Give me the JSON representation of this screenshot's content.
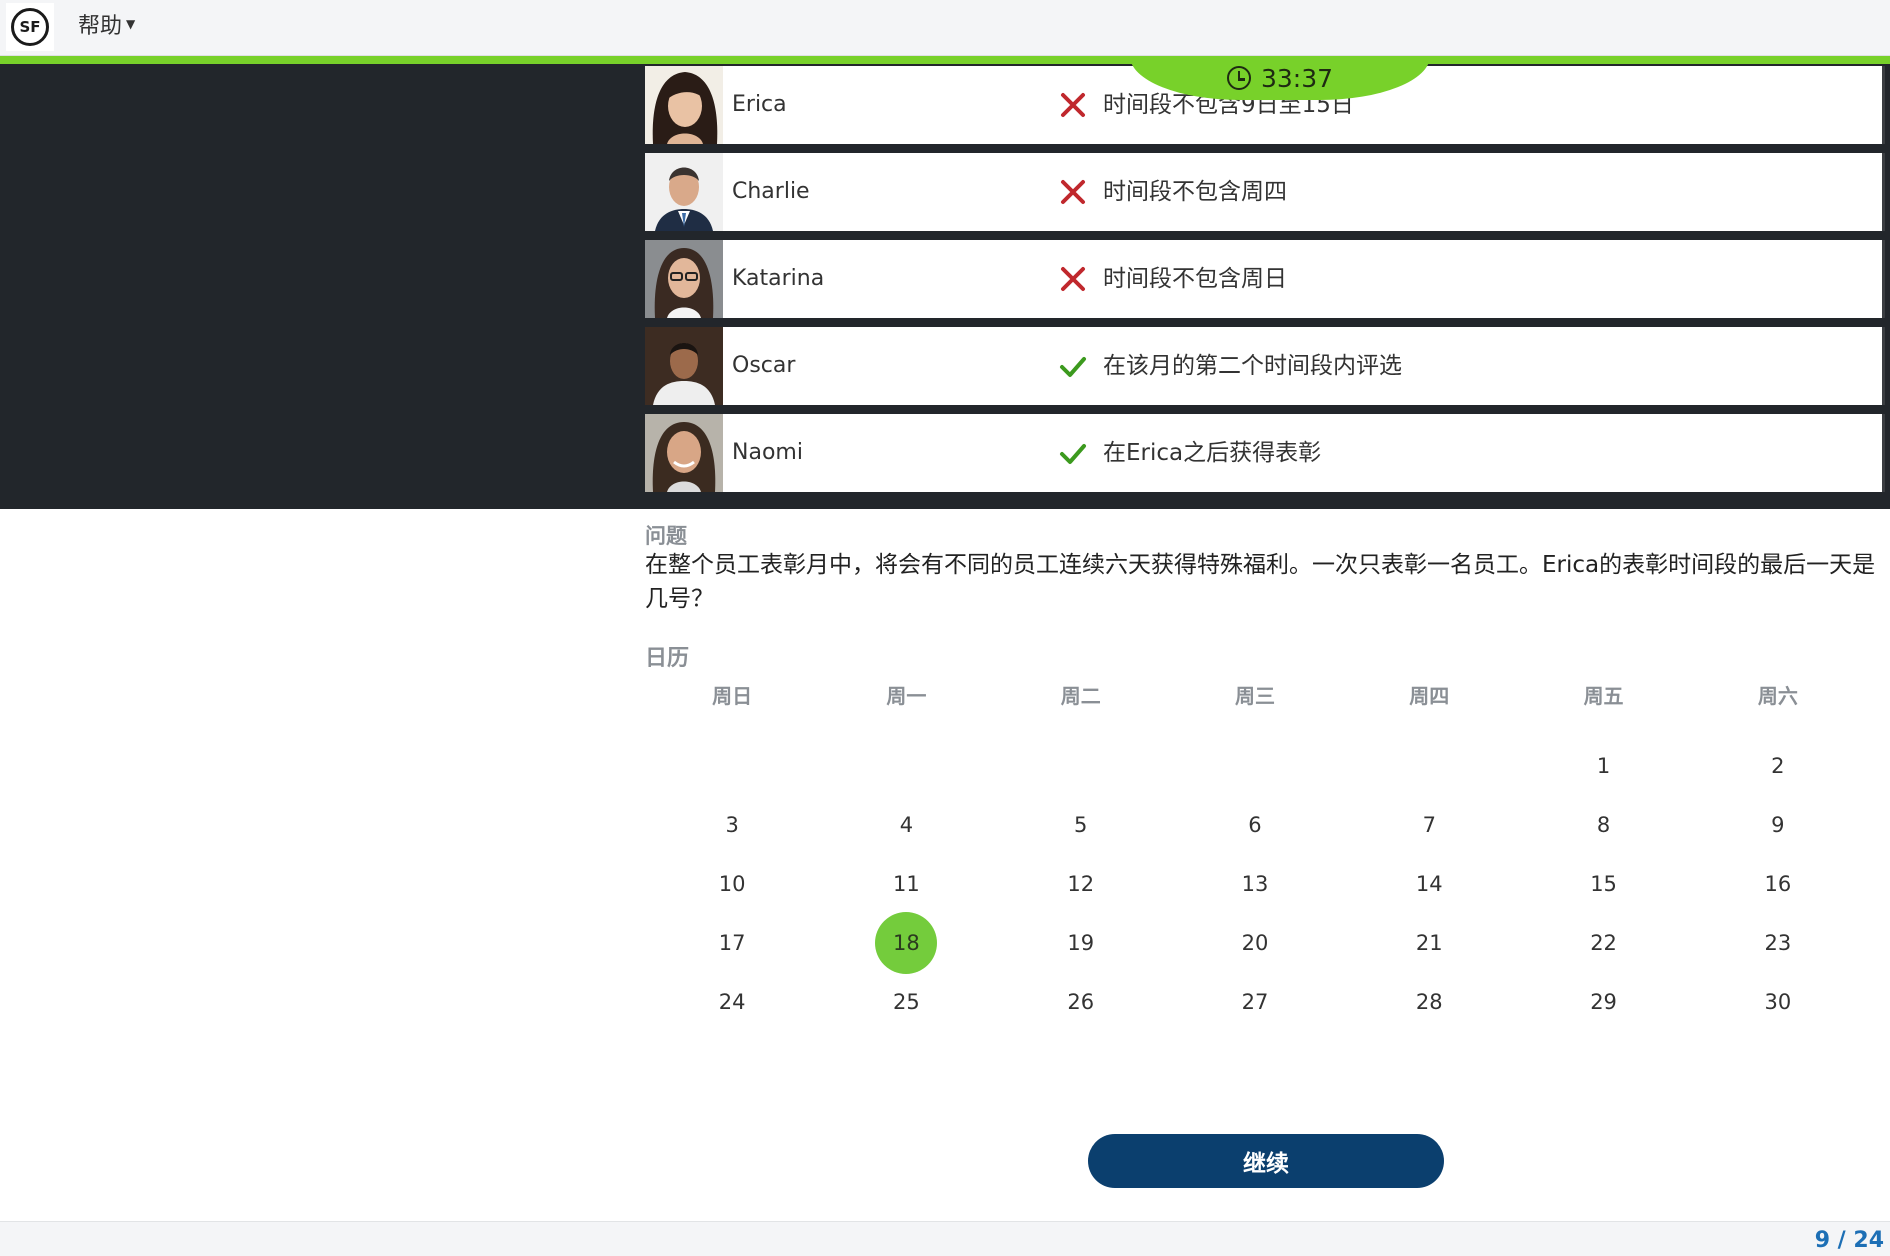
{
  "header": {
    "logo_text": "SF",
    "help_label": "帮助"
  },
  "timer": {
    "value": "33:37"
  },
  "candidates": [
    {
      "name": "Erica",
      "status": "wrong",
      "reason": "时间段不包含9日至15日"
    },
    {
      "name": "Charlie",
      "status": "wrong",
      "reason": "时间段不包含周四"
    },
    {
      "name": "Katarina",
      "status": "wrong",
      "reason": "时间段不包含周日"
    },
    {
      "name": "Oscar",
      "status": "correct",
      "reason": "在该月的第二个时间段内评选"
    },
    {
      "name": "Naomi",
      "status": "correct",
      "reason": "在Erica之后获得表彰"
    }
  ],
  "question": {
    "label": "问题",
    "text": "在整个员工表彰月中，将会有不同的员工连续六天获得特殊福利。一次只表彰一名员工。Erica的表彰时间段的最后一天是几号？"
  },
  "calendar": {
    "label": "日历",
    "weekdays": [
      "周日",
      "周一",
      "周二",
      "周三",
      "周四",
      "周五",
      "周六"
    ],
    "weeks": [
      [
        "",
        "",
        "",
        "",
        "",
        "1",
        "2"
      ],
      [
        "3",
        "4",
        "5",
        "6",
        "7",
        "8",
        "9"
      ],
      [
        "10",
        "11",
        "12",
        "13",
        "14",
        "15",
        "16"
      ],
      [
        "17",
        "18",
        "19",
        "20",
        "21",
        "22",
        "23"
      ],
      [
        "24",
        "25",
        "26",
        "27",
        "28",
        "29",
        "30"
      ]
    ],
    "selected": "18"
  },
  "continue_label": "继续",
  "pager": "9 / 24",
  "colors": {
    "accent_green": "#78d12a",
    "dark_panel": "#22262b",
    "primary_button": "#0b3f6e",
    "wrong_mark": "#c0282d",
    "correct_mark": "#3c9a1e",
    "pager_blue": "#1d6fb5"
  },
  "icons": {
    "timer": "clock-icon",
    "wrong": "x-icon",
    "correct": "check-icon",
    "help": "chevron-down-icon"
  }
}
